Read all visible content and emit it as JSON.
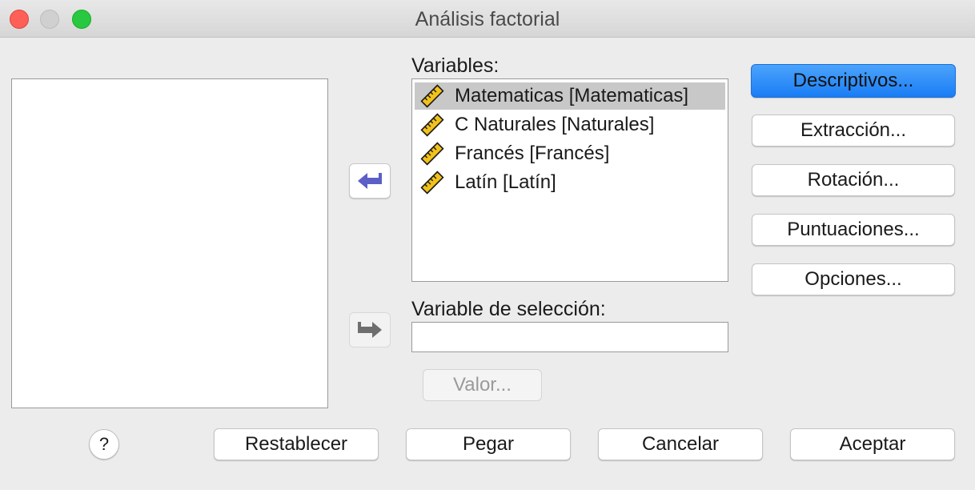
{
  "window": {
    "title": "Análisis factorial"
  },
  "variables": {
    "label": "Variables:",
    "items": [
      {
        "label": "Matematicas [Matematicas]",
        "selected": true
      },
      {
        "label": "C Naturales [Naturales]",
        "selected": false
      },
      {
        "label": "Francés [Francés]",
        "selected": false
      },
      {
        "label": "Latín [Latín]",
        "selected": false
      }
    ]
  },
  "selection": {
    "label": "Variable de selección:",
    "value": "",
    "value_button": "Valor..."
  },
  "side_buttons": {
    "descriptivos": "Descriptivos...",
    "extraccion": "Extracción...",
    "rotacion": "Rotación...",
    "puntuaciones": "Puntuaciones...",
    "opciones": "Opciones..."
  },
  "footer": {
    "help": "?",
    "reset": "Restablecer",
    "paste": "Pegar",
    "cancel": "Cancelar",
    "ok": "Aceptar"
  },
  "colors": {
    "accent": "#1a7df5",
    "arrow_active": "#5b5fc7",
    "arrow_disabled": "#6e6e6e"
  },
  "icons": {
    "variable_icon": "ruler-icon"
  }
}
